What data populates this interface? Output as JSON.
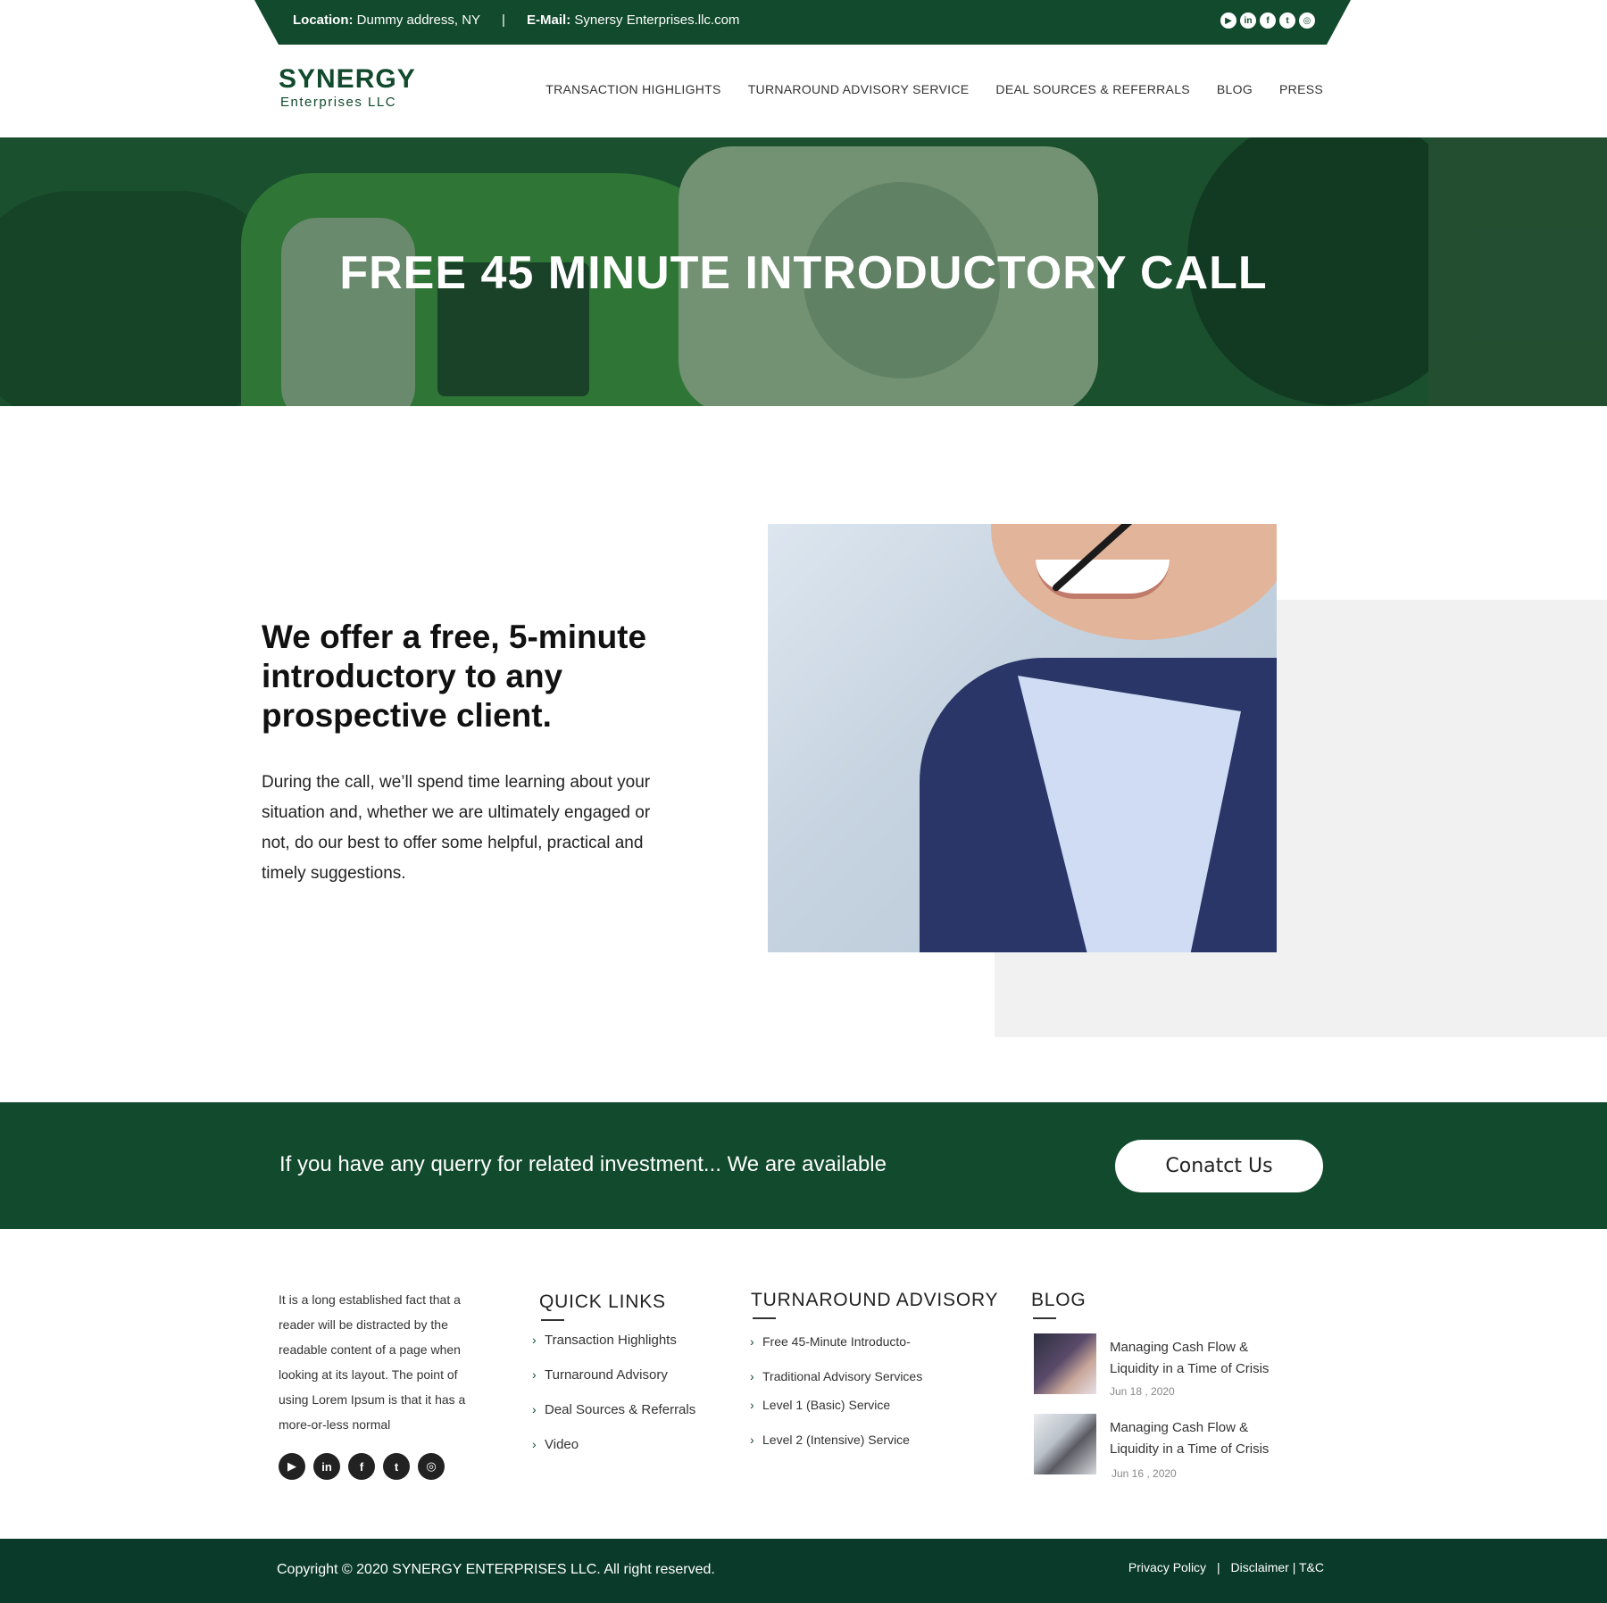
{
  "topbar": {
    "location_label": "Location:",
    "location_value": "Dummy address, NY",
    "separator": "|",
    "email_label": "E-Mail:",
    "email_value": "Synersy Enterprises.llc.com",
    "social_icons": [
      "youtube-icon",
      "linkedin-icon",
      "facebook-icon",
      "twitter-icon",
      "instagram-icon"
    ]
  },
  "logo": {
    "name": "SYNERGY",
    "subtitle": "Enterprises LLC"
  },
  "nav": {
    "items": [
      "TRANSACTION HIGHLIGHTS",
      "TURNAROUND ADVISORY SERVICE",
      "DEAL SOURCES & REFERRALS",
      "BLOG",
      "PRESS"
    ]
  },
  "hero": {
    "title": "FREE 45 MINUTE INTRODUCTORY CALL"
  },
  "intro": {
    "heading": "We offer a free, 5-minute introductory to any prospective client.",
    "body": "During the call, we’ll spend time learning about your situation and, whether we are ultimately engaged or not, do our best to offer some helpful, practical and timely suggestions."
  },
  "cta": {
    "text": "If you have any querry for related investment... We are available",
    "button": "Conatct Us"
  },
  "footer": {
    "about": "It is a long established fact that a reader will be distracted by the readable content of a page when looking at its layout. The point of using Lorem Ipsum is that it has a more-or-less normal",
    "quick_links": {
      "title": "QUICK LINKS",
      "items": [
        "Transaction Highlights",
        "Turnaround Advisory",
        "Deal Sources & Referrals",
        "Video"
      ]
    },
    "turnaround": {
      "title": "TURNAROUND ADVISORY",
      "items": [
        "Free 45-Minute Introducto-",
        "Traditional Advisory Services",
        "Level 1 (Basic) Service",
        "Level 2 (Intensive) Service"
      ]
    },
    "blog": {
      "title": "BLOG",
      "posts": [
        {
          "title": "Managing Cash Flow & Liquidity in a Time of Crisis",
          "date": "Jun 18 , 2020"
        },
        {
          "title": "Managing Cash Flow & Liquidity in a Time of Crisis",
          "date": "Jun 16 , 2020"
        }
      ]
    }
  },
  "bottom": {
    "copyright": "Copyright © 2020 SYNERGY ENTERPRISES LLC. All right reserved.",
    "privacy": "Privacy Policy",
    "divider": "|",
    "disclaimer": "Disclaimer",
    "tc": "| T&C"
  },
  "colors": {
    "brand_green": "#114a2c",
    "footer_dark": "#093a2a",
    "light_gray": "#f1f1f1"
  }
}
